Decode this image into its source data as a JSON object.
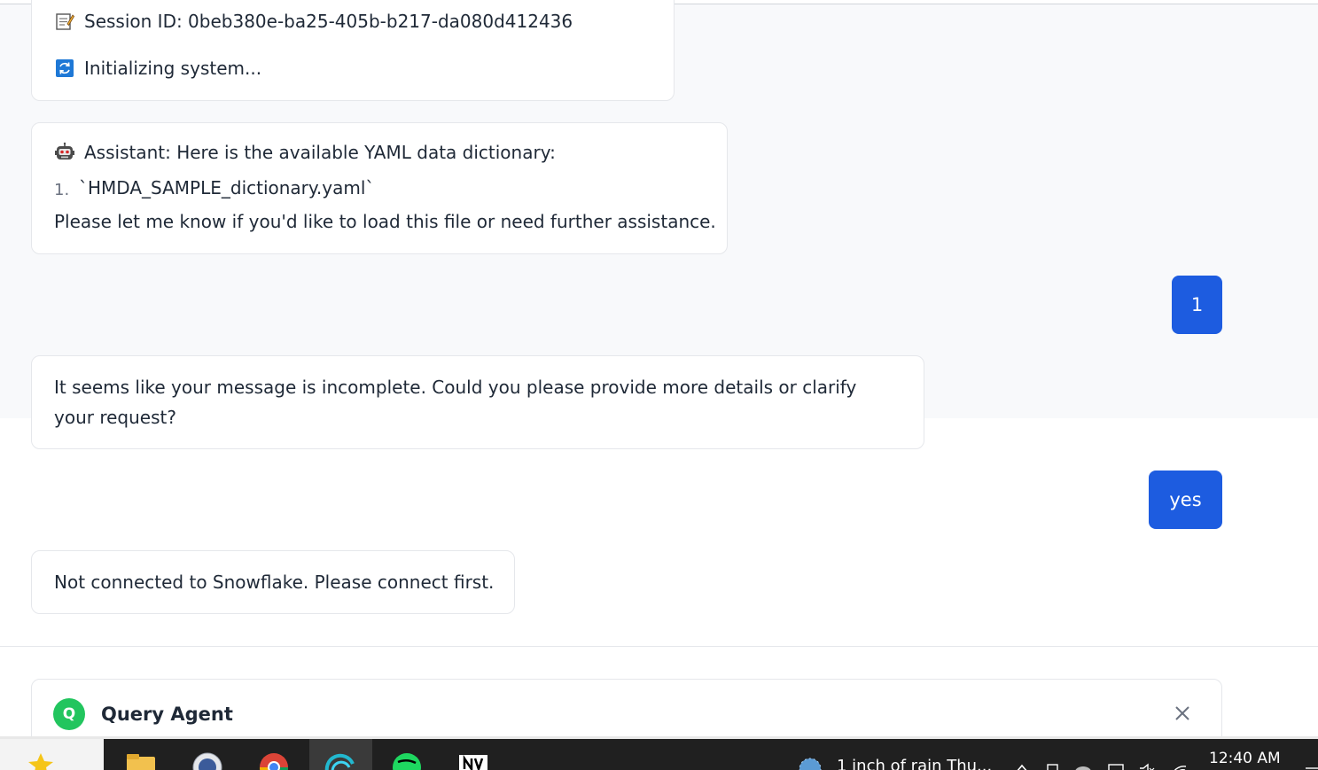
{
  "messages": {
    "session": {
      "session_line": "Session ID: 0beb380e-ba25-405b-b217-da080d412436",
      "init_line": "Initializing system..."
    },
    "assistant_yaml": {
      "intro": "Assistant: Here is the available YAML data dictionary:",
      "list_number": "1.",
      "list_item": "`HMDA_SAMPLE_dictionary.yaml`",
      "followup": "Please let me know if you'd like to load this file or need further assistance."
    },
    "user_1": "1",
    "assistant_incomplete": "It seems like your message is incomplete. Could you please provide more details or clarify your request?",
    "user_2": "yes",
    "assistant_not_connected": "Not connected to Snowflake. Please connect first."
  },
  "agent_panel": {
    "avatar_letter": "Q",
    "title": "Query Agent"
  },
  "taskbar": {
    "weather": "1 inch of rain Thu...",
    "clock": "12:40 AM"
  },
  "colors": {
    "user_bubble": "#1d5ce0",
    "agent_avatar": "#22c55e",
    "chat_background": "#f8f9fb"
  },
  "icons": {
    "session": "memo-icon",
    "init": "refresh-icon",
    "assistant": "robot-icon",
    "close": "close-icon"
  }
}
